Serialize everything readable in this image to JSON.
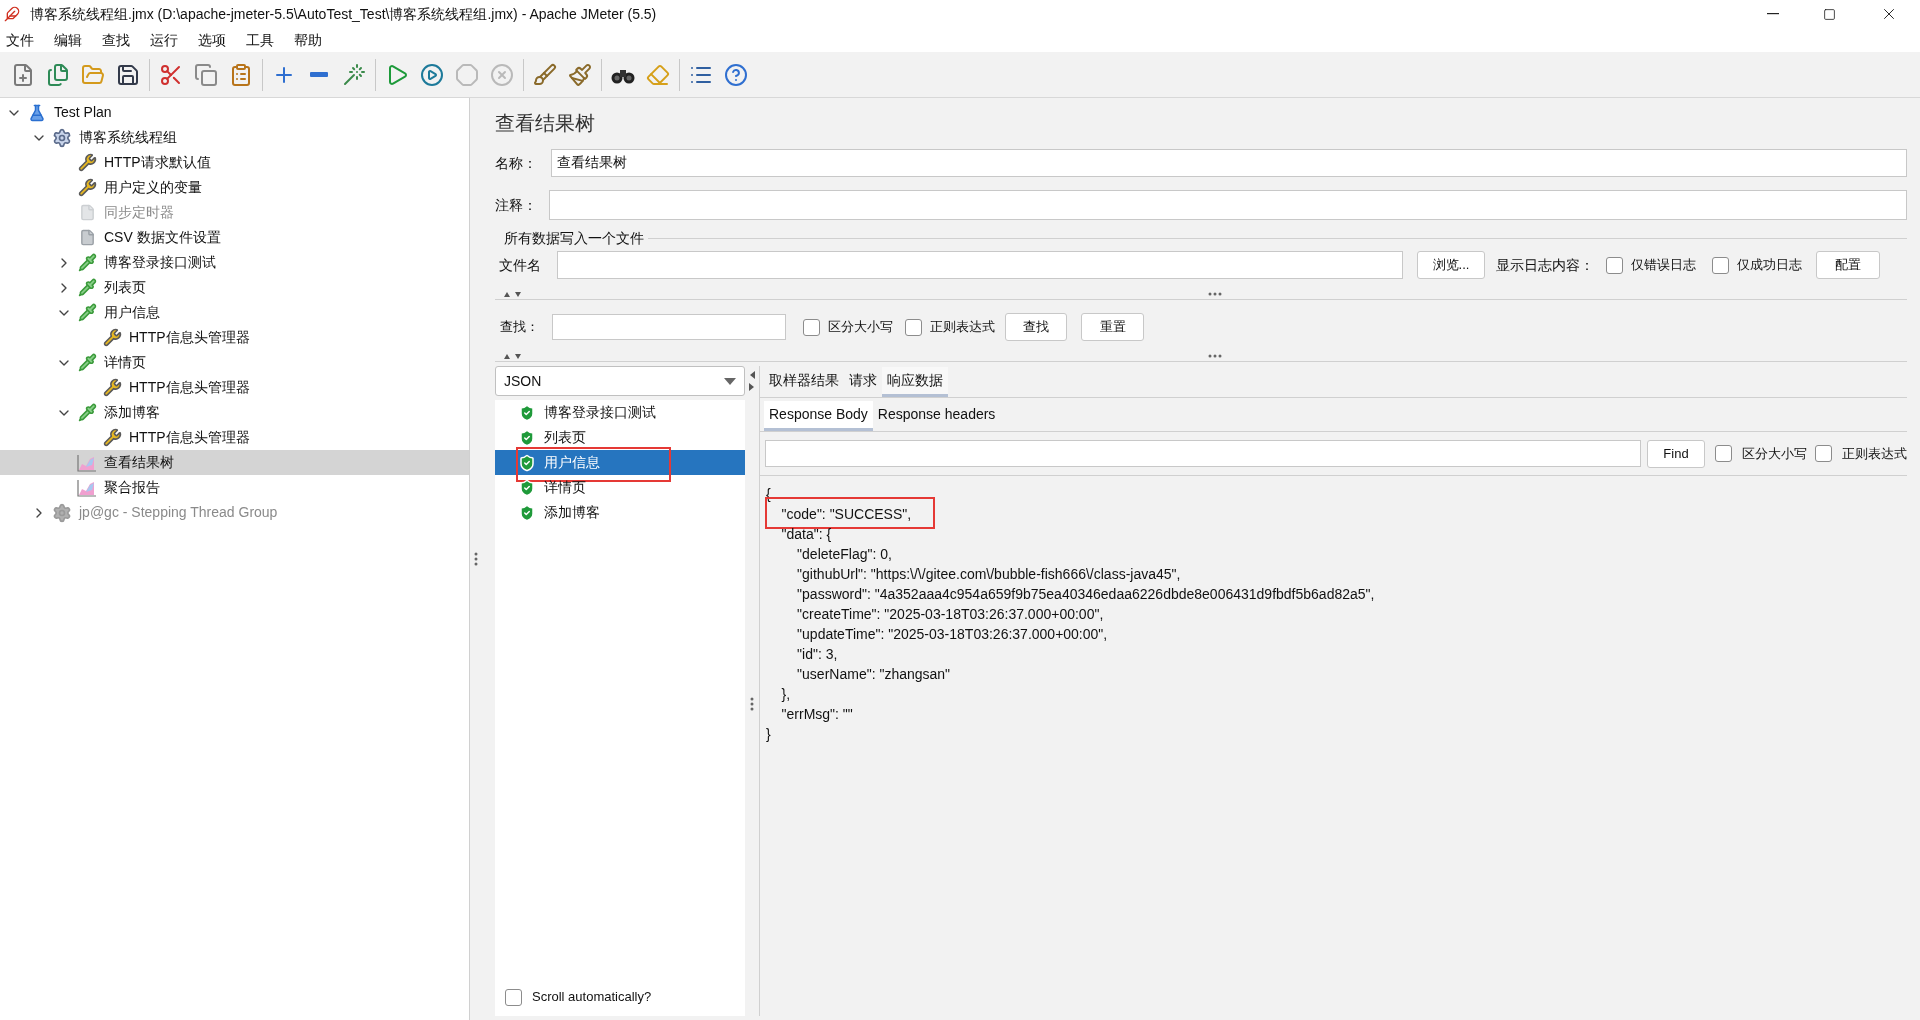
{
  "window": {
    "title": "博客系统线程组.jmx (D:\\apache-jmeter-5.5\\AutoTest_Test\\博客系统线程组.jmx) - Apache JMeter (5.5)"
  },
  "menu": [
    "文件",
    "编辑",
    "查找",
    "运行",
    "选项",
    "工具",
    "帮助"
  ],
  "toolbar": [
    [
      {
        "kind": "new",
        "disabled": false
      },
      {
        "kind": "templates",
        "disabled": false
      },
      {
        "kind": "open",
        "disabled": false
      },
      {
        "kind": "save",
        "disabled": false
      }
    ],
    [
      {
        "kind": "cut",
        "disabled": false
      },
      {
        "kind": "copy",
        "disabled": false
      },
      {
        "kind": "paste",
        "disabled": false
      }
    ],
    [
      {
        "kind": "expand",
        "disabled": false
      },
      {
        "kind": "collapse",
        "disabled": false
      },
      {
        "kind": "toggle",
        "disabled": false
      }
    ],
    [
      {
        "kind": "start",
        "disabled": false
      },
      {
        "kind": "start-no-pause",
        "disabled": false
      },
      {
        "kind": "stop",
        "disabled": true
      },
      {
        "kind": "shutdown",
        "disabled": true
      }
    ],
    [
      {
        "kind": "clear",
        "disabled": false
      },
      {
        "kind": "clear-all",
        "disabled": false
      }
    ],
    [
      {
        "kind": "search",
        "disabled": false
      },
      {
        "kind": "reset-search",
        "disabled": false
      }
    ],
    [
      {
        "kind": "function-helper",
        "disabled": false
      },
      {
        "kind": "help",
        "disabled": false
      }
    ]
  ],
  "tree": [
    {
      "label": "Test Plan",
      "kind": "plan",
      "expanded": true,
      "selected": false,
      "disabled": false,
      "children": [
        {
          "label": "博客系统线程组",
          "kind": "thread-group",
          "expanded": true,
          "selected": false,
          "disabled": false,
          "children": [
            {
              "label": "HTTP请求默认值",
              "kind": "config",
              "selected": false,
              "disabled": false
            },
            {
              "label": "用户定义的变量",
              "kind": "config",
              "selected": false,
              "disabled": false
            },
            {
              "label": "同步定时器",
              "kind": "document",
              "selected": false,
              "disabled": true
            },
            {
              "label": "CSV 数据文件设置",
              "kind": "document",
              "selected": false,
              "disabled": false
            },
            {
              "label": "博客登录接口测试",
              "kind": "sampler",
              "expanded": false,
              "selected": false,
              "disabled": false
            },
            {
              "label": "列表页",
              "kind": "sampler",
              "expanded": false,
              "selected": false,
              "disabled": false
            },
            {
              "label": "用户信息",
              "kind": "sampler",
              "expanded": true,
              "selected": false,
              "disabled": false,
              "children": [
                {
                  "label": "HTTP信息头管理器",
                  "kind": "config",
                  "selected": false,
                  "disabled": false
                }
              ]
            },
            {
              "label": "详情页",
              "kind": "sampler",
              "expanded": true,
              "selected": false,
              "disabled": false,
              "children": [
                {
                  "label": "HTTP信息头管理器",
                  "kind": "config",
                  "selected": false,
                  "disabled": false
                }
              ]
            },
            {
              "label": "添加博客",
              "kind": "sampler",
              "expanded": true,
              "selected": false,
              "disabled": false,
              "children": [
                {
                  "label": "HTTP信息头管理器",
                  "kind": "config",
                  "selected": false,
                  "disabled": false
                }
              ]
            },
            {
              "label": "查看结果树",
              "kind": "listener",
              "selected": true,
              "disabled": false
            },
            {
              "label": "聚合报告",
              "kind": "listener",
              "selected": false,
              "disabled": false
            }
          ]
        },
        {
          "label": "jp@gc - Stepping Thread Group",
          "kind": "thread-group",
          "expanded": false,
          "selected": false,
          "disabled": true
        }
      ]
    }
  ],
  "panel": {
    "title": "查看结果树",
    "name_label": "名称：",
    "name_value": "查看结果树",
    "comment_label": "注释：",
    "file_section": "所有数据写入一个文件",
    "file_label": "文件名",
    "browse": "浏览...",
    "log_label": "显示日志内容：",
    "log_options": [
      {
        "label": "仅错误日志",
        "checked": false
      },
      {
        "label": "仅成功日志",
        "checked": false
      }
    ],
    "configure": "配置"
  },
  "search": {
    "label": "查找：",
    "options": [
      {
        "label": "区分大小写",
        "checked": false
      },
      {
        "label": "正则表达式",
        "checked": false
      }
    ],
    "find": "查找",
    "reset": "重置"
  },
  "renderer": {
    "value": "JSON"
  },
  "results": [
    {
      "label": "博客登录接口测试",
      "success": true,
      "selected": false,
      "annotated": false
    },
    {
      "label": "列表页",
      "success": true,
      "selected": false,
      "annotated": false
    },
    {
      "label": "用户信息",
      "success": true,
      "selected": true,
      "annotated": true
    },
    {
      "label": "详情页",
      "success": true,
      "selected": false,
      "annotated": false
    },
    {
      "label": "添加博客",
      "success": true,
      "selected": false,
      "annotated": false
    }
  ],
  "scroll_auto": {
    "label": "Scroll automatically?",
    "checked": false
  },
  "tabs": [
    {
      "label": "取样器结果",
      "selected": false
    },
    {
      "label": "请求",
      "selected": false
    },
    {
      "label": "响应数据",
      "selected": true
    }
  ],
  "subtabs": [
    {
      "label": "Response Body",
      "selected": true
    },
    {
      "label": "Response headers",
      "selected": false
    }
  ],
  "body_search": {
    "find": "Find",
    "options": [
      {
        "label": "区分大小写",
        "checked": false
      },
      {
        "label": "正则表达式",
        "checked": false
      }
    ]
  },
  "response_lines": [
    {
      "text": "{",
      "annotated": false
    },
    {
      "text": "    \"code\": \"SUCCESS\",",
      "annotated": true
    },
    {
      "text": "    \"data\": {",
      "annotated": false
    },
    {
      "text": "        \"deleteFlag\": 0,",
      "annotated": false
    },
    {
      "text": "        \"githubUrl\": \"https:\\/\\/gitee.com\\/bubble-fish666\\/class-java45\",",
      "annotated": false
    },
    {
      "text": "        \"password\": \"4a352aaa4c954a659f9b75ea40346edaa6226dbde8e006431d9fbdf5b6ad82a5\",",
      "annotated": false
    },
    {
      "text": "        \"createTime\": \"2025-03-18T03:26:37.000+00:00\",",
      "annotated": false
    },
    {
      "text": "        \"updateTime\": \"2025-03-18T03:26:37.000+00:00\",",
      "annotated": false
    },
    {
      "text": "        \"id\": 3,",
      "annotated": false
    },
    {
      "text": "        \"userName\": \"zhangsan\"",
      "annotated": false
    },
    {
      "text": "    },",
      "annotated": false
    },
    {
      "text": "    \"errMsg\": \"\"",
      "annotated": false
    },
    {
      "text": "}",
      "annotated": false
    }
  ]
}
